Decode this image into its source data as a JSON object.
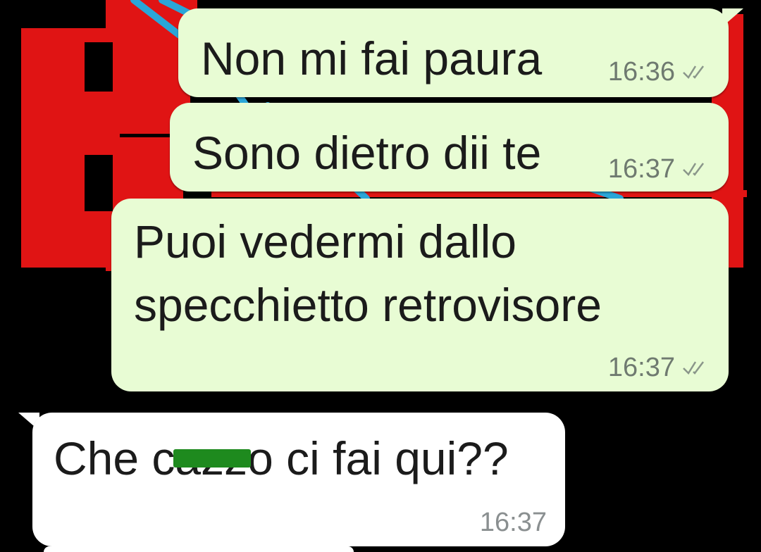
{
  "colors": {
    "outgoing_bubble": "#e8fcd4",
    "incoming_bubble": "#ffffff",
    "wallpaper_red": "#e01414",
    "wallpaper_blue": "#2aa6d8",
    "censor_bar": "#1e8a1e"
  },
  "messages": [
    {
      "direction": "outgoing",
      "lines": [
        "Non mi fai paura"
      ],
      "time": "16:36",
      "status_icon": "double-check-icon"
    },
    {
      "direction": "outgoing",
      "lines": [
        "Sono dietro dii te"
      ],
      "time": "16:37",
      "status_icon": "double-check-icon"
    },
    {
      "direction": "outgoing",
      "lines": [
        "Puoi vedermi dallo",
        "specchietto retrovisore"
      ],
      "time": "16:37",
      "status_icon": "double-check-icon"
    },
    {
      "direction": "incoming",
      "lines": [
        "Che cazzo ci fai qui??"
      ],
      "time": "16:37",
      "censored": true
    }
  ]
}
